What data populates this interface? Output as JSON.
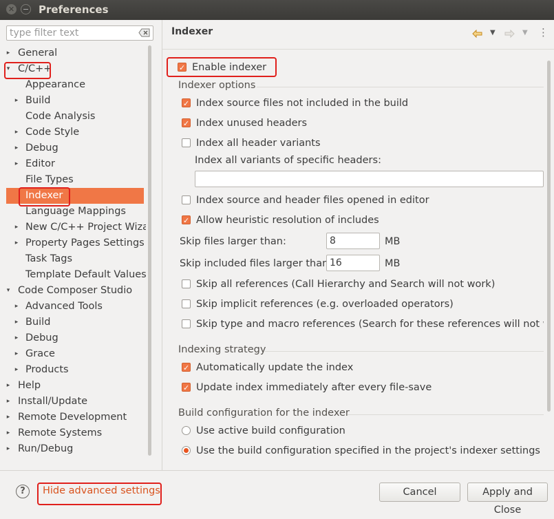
{
  "window": {
    "title": "Preferences"
  },
  "filter": {
    "placeholder": "type filter text"
  },
  "tree": [
    {
      "label": "General",
      "arrow": "▸"
    },
    {
      "label": "C/C++",
      "arrow": "▾"
    },
    {
      "label": "Appearance",
      "arrow": ""
    },
    {
      "label": "Build",
      "arrow": "▸"
    },
    {
      "label": "Code Analysis",
      "arrow": ""
    },
    {
      "label": "Code Style",
      "arrow": "▸"
    },
    {
      "label": "Debug",
      "arrow": "▸"
    },
    {
      "label": "Editor",
      "arrow": "▸"
    },
    {
      "label": "File Types",
      "arrow": ""
    },
    {
      "label": "Indexer",
      "arrow": ""
    },
    {
      "label": "Language Mappings",
      "arrow": ""
    },
    {
      "label": "New C/C++ Project Wizard",
      "arrow": "▸"
    },
    {
      "label": "Property Pages Settings",
      "arrow": "▸"
    },
    {
      "label": "Task Tags",
      "arrow": ""
    },
    {
      "label": "Template Default Values",
      "arrow": ""
    },
    {
      "label": "Code Composer Studio",
      "arrow": "▾"
    },
    {
      "label": "Advanced Tools",
      "arrow": "▸"
    },
    {
      "label": "Build",
      "arrow": "▸"
    },
    {
      "label": "Debug",
      "arrow": "▸"
    },
    {
      "label": "Grace",
      "arrow": "▸"
    },
    {
      "label": "Products",
      "arrow": "▸"
    },
    {
      "label": "Help",
      "arrow": "▸"
    },
    {
      "label": "Install/Update",
      "arrow": "▸"
    },
    {
      "label": "Remote Development",
      "arrow": "▸"
    },
    {
      "label": "Remote Systems",
      "arrow": "▸"
    },
    {
      "label": "Run/Debug",
      "arrow": "▸"
    }
  ],
  "page": {
    "title": "Indexer",
    "enable_indexer": "Enable indexer",
    "indexer_options": {
      "title": "Indexer options",
      "index_source_not_in_build": "Index source files not included in the build",
      "index_unused_headers": "Index unused headers",
      "index_all_header_variants": "Index all header variants",
      "index_all_variants_specific": "Index all variants of specific headers:",
      "specific_headers_value": "",
      "index_opened_in_editor": "Index source and header files opened in editor",
      "allow_heuristic": "Allow heuristic resolution of includes",
      "skip_files_larger": "Skip files larger than:",
      "skip_files_larger_value": "8",
      "skip_included_larger": "Skip included files larger than:",
      "skip_included_larger_value": "16",
      "unit_mb": "MB",
      "skip_all_references": "Skip all references (Call Hierarchy and Search will not work)",
      "skip_implicit_references": "Skip implicit references (e.g. overloaded operators)",
      "skip_type_macro_references": "Skip type and macro references (Search for these references will not work)"
    },
    "indexing_strategy": {
      "title": "Indexing strategy",
      "auto_update": "Automatically update the index",
      "update_after_save": "Update index immediately after every file-save"
    },
    "build_config": {
      "title": "Build configuration for the indexer",
      "use_active": "Use active build configuration",
      "use_specified": "Use the build configuration specified in the project's indexer settings"
    }
  },
  "footer": {
    "help_icon": "?",
    "hide_advanced": "Hide advanced settings",
    "cancel": "Cancel",
    "apply_close": "Apply and Close"
  },
  "colors": {
    "accent": "#f07746",
    "highlight_box": "#e0201c",
    "link": "#d9531e"
  }
}
